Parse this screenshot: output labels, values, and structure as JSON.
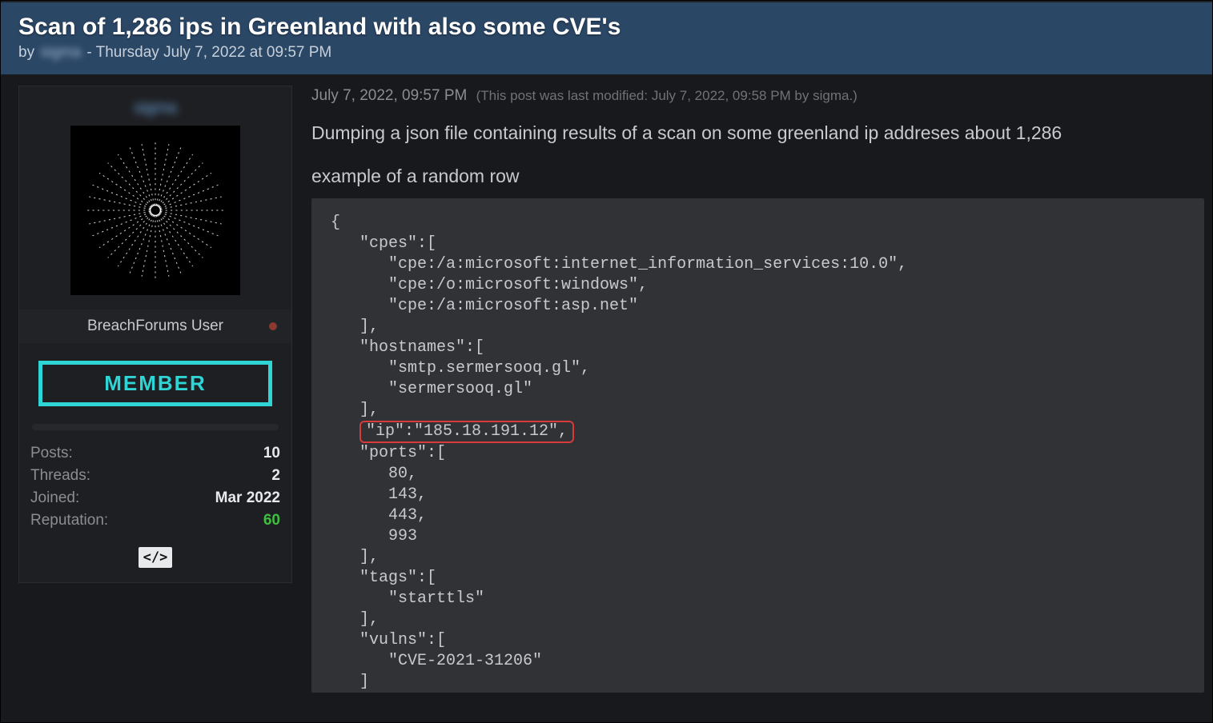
{
  "header": {
    "title": "Scan of 1,286 ips in Greenland with also some CVE's",
    "by_label": "by",
    "username_blurred": "sigma",
    "timestamp": "- Thursday July 7, 2022 at 09:57 PM"
  },
  "sidebar": {
    "username_blurred": "sigma",
    "role": "BreachForums User",
    "member_badge": "MEMBER",
    "stats": {
      "posts_label": "Posts:",
      "posts_value": "10",
      "threads_label": "Threads:",
      "threads_value": "2",
      "joined_label": "Joined:",
      "joined_value": "Mar 2022",
      "reputation_label": "Reputation:",
      "reputation_value": "60"
    },
    "code_icon": "</>"
  },
  "post": {
    "post_time": "July 7, 2022, 09:57 PM",
    "modified_note": "(This post was last modified: July 7, 2022, 09:58 PM by sigma.)",
    "body_line1": "Dumping a json file containing results of a scan on some greenland ip addreses about 1,286",
    "body_line2": "example of a random row",
    "code": {
      "l01": "{",
      "l02": "   \"cpes\":[",
      "l03": "      \"cpe:/a:microsoft:internet_information_services:10.0\",",
      "l04": "      \"cpe:/o:microsoft:windows\",",
      "l05": "      \"cpe:/a:microsoft:asp.net\"",
      "l06": "   ],",
      "l07": "   \"hostnames\":[",
      "l08": "      \"smtp.sermersooq.gl\",",
      "l09": "      \"sermersooq.gl\"",
      "l10": "   ],",
      "l11_hl": "\"ip\":\"185.18.191.12\",",
      "l12": "   \"ports\":[",
      "l13": "      80,",
      "l14": "      143,",
      "l15": "      443,",
      "l16": "      993",
      "l17": "   ],",
      "l18": "   \"tags\":[",
      "l19": "      \"starttls\"",
      "l20": "   ],",
      "l21": "   \"vulns\":[",
      "l22": "      \"CVE-2021-31206\"",
      "l23": "   ]"
    }
  }
}
